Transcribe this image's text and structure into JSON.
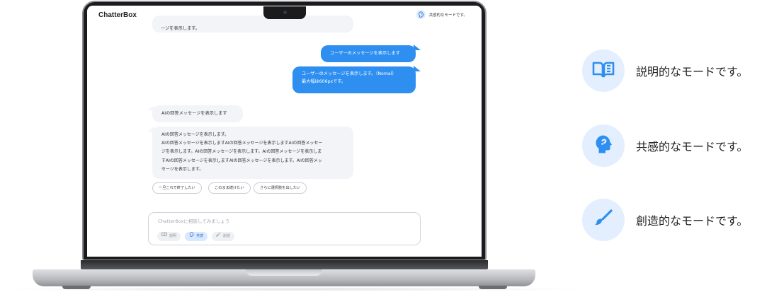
{
  "app": {
    "title": "ChatterBox",
    "current_mode": "共感的なモードです。"
  },
  "messages": {
    "ai_partial": "ージを表示します。",
    "user_short": "ユーザーのメッセージを表示します",
    "user_long_line1": "ユーザーのメッセージを表示します。（Nomal）",
    "user_long_line2": "最大幅は606pxです。",
    "ai_short": "AIの回答メッセージを表示します",
    "ai_long_line1": "AIの回答メッセージを表示します。",
    "ai_long_line2": "AIの回答メッセージを表示しますAIの回答メッセージを表示しますAIの回答メッセー",
    "ai_long_line3": "ジを表示します。AIの回答メッセージを表示します。AIの回答メッセージを表示しま",
    "ai_long_line4": "すAIの回答メッセージを表示しますAIの回答メッセージを表示します。AIの回答メッ",
    "ai_long_line5": "セージを表示します。"
  },
  "suggestions": [
    "一旦これで終了したい",
    "このまま続けたい",
    "さらに選択肢を出したい"
  ],
  "composer": {
    "placeholder": "ChatterBoxに相談してみましょう",
    "modes": [
      {
        "label": "説明",
        "icon": "book-icon",
        "active": false
      },
      {
        "label": "共感",
        "icon": "empathy-head-icon",
        "active": true
      },
      {
        "label": "創造",
        "icon": "brush-icon",
        "active": false
      }
    ]
  },
  "features": [
    {
      "label": "説明的なモードです。",
      "icon": "book-icon"
    },
    {
      "label": "共感的なモードです。",
      "icon": "empathy-head-icon"
    },
    {
      "label": "創造的なモードです。",
      "icon": "brush-icon"
    }
  ],
  "colors": {
    "accent": "#2f8ff0",
    "icon_circle": "#e3efff",
    "ai_bubble": "#f2f4f8"
  }
}
